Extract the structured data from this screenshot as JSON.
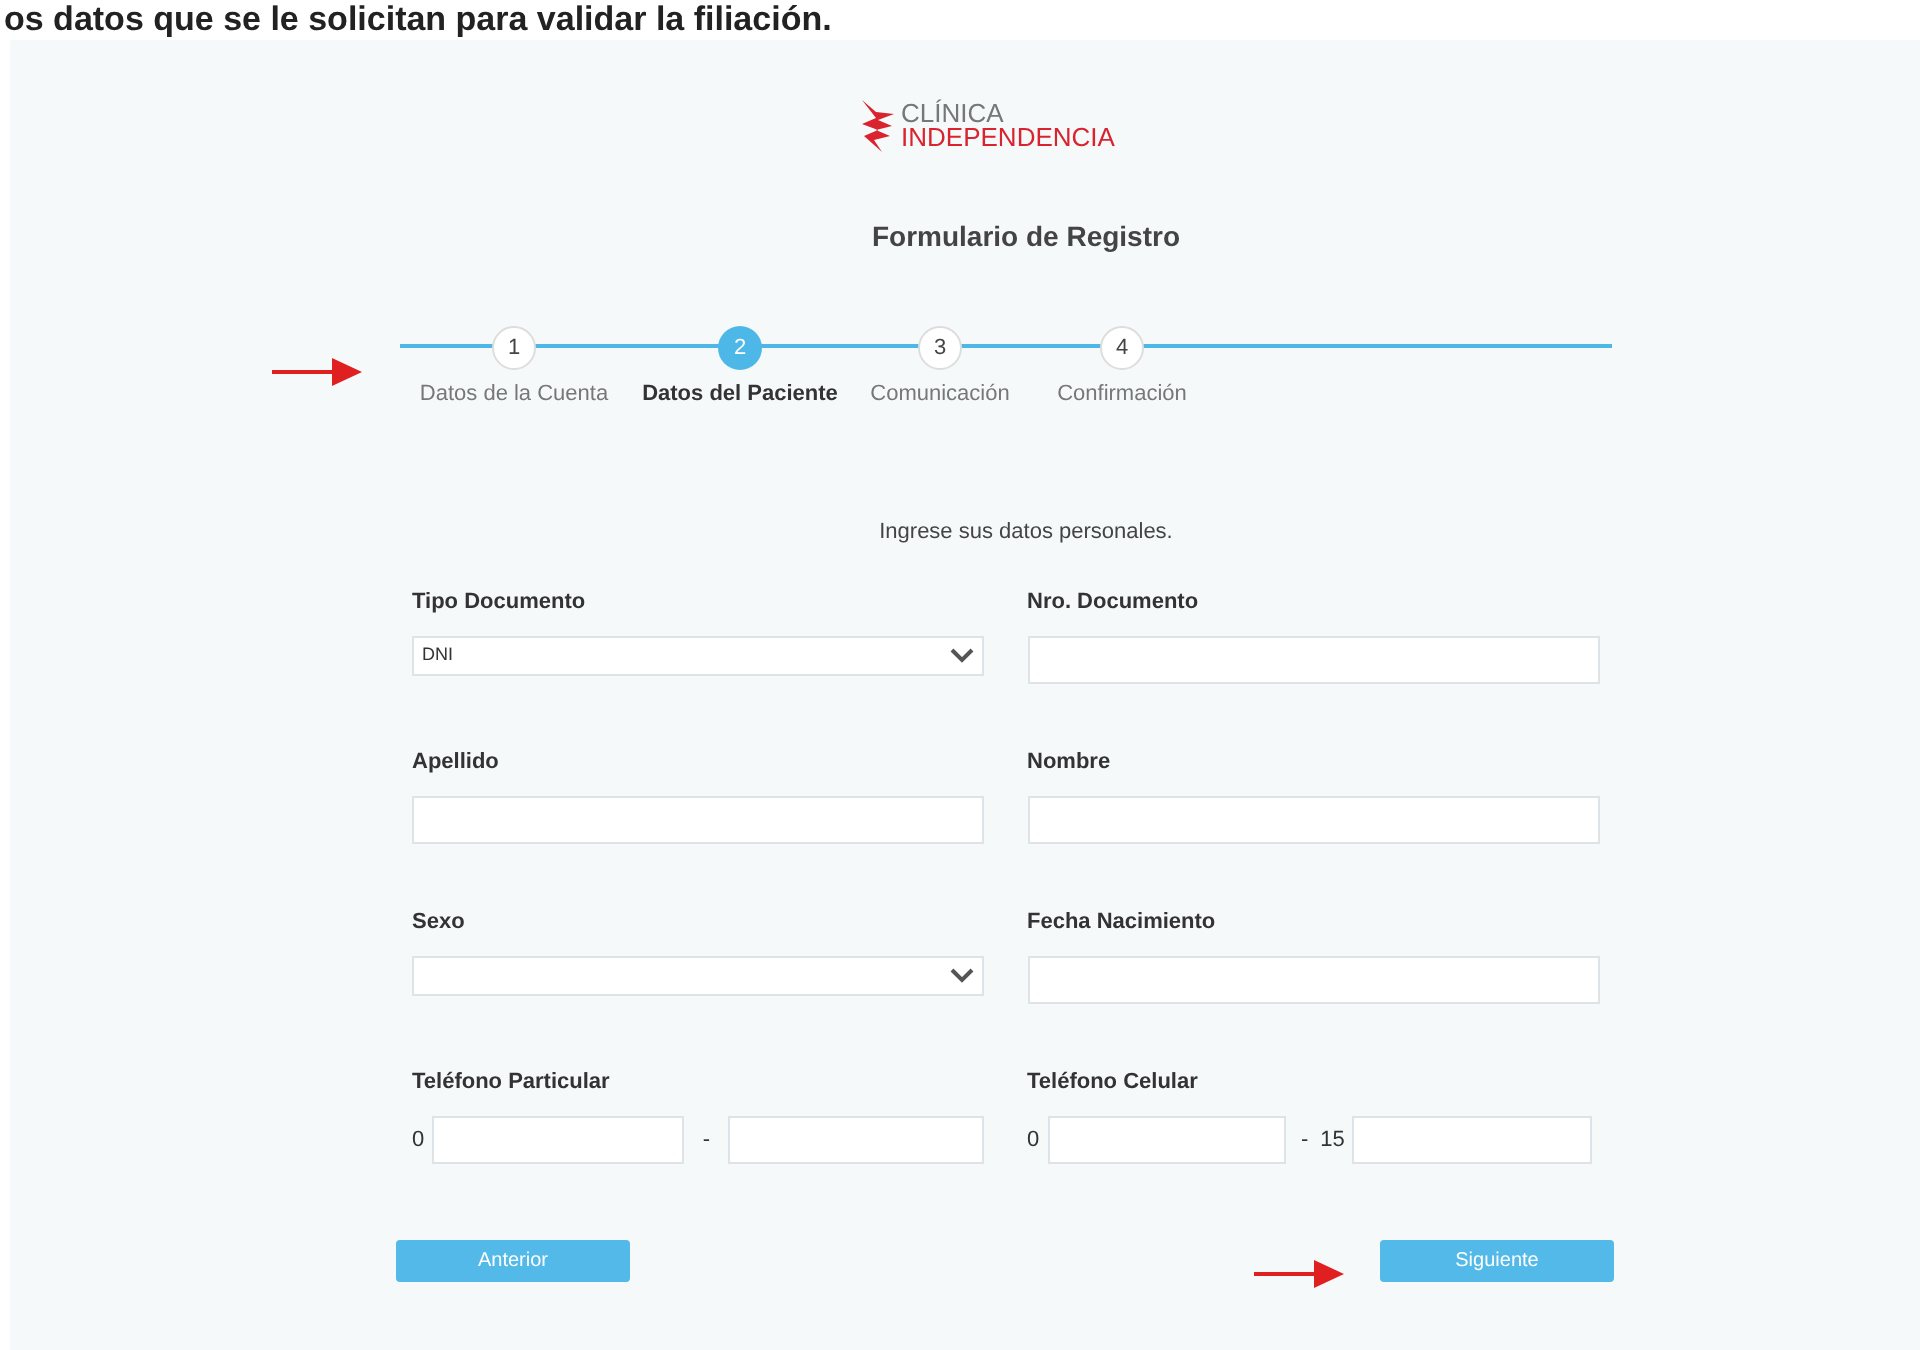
{
  "banner_text": "os datos que se le solicitan para validar la filiación.",
  "logo": {
    "line_1": "CLÍNICA",
    "line_2": "INDEPENDENCIA"
  },
  "title": "Formulario de Registro",
  "steps": [
    {
      "number": "1",
      "label": "Datos de la Cuenta",
      "selected": false
    },
    {
      "number": "2",
      "label": "Datos del Paciente",
      "selected": true
    },
    {
      "number": "3",
      "label": "Comunicación",
      "selected": false
    },
    {
      "number": "4",
      "label": "Confirmación",
      "selected": false
    }
  ],
  "instruction": "Ingrese sus datos personales.",
  "fields": [
    {
      "kind": "select",
      "label": "Tipo Documento",
      "value": "DNI"
    },
    {
      "kind": "text",
      "label": "Nro. Documento"
    },
    {
      "kind": "text",
      "label": "Apellido"
    },
    {
      "kind": "text",
      "label": "Nombre"
    },
    {
      "kind": "select",
      "label": "Sexo"
    },
    {
      "kind": "text",
      "label": "Fecha Nacimiento"
    },
    {
      "kind": "phone",
      "label": "Teléfono Particular",
      "prefix": "0",
      "separator": "-"
    },
    {
      "kind": "phone",
      "label": "Teléfono Celular",
      "prefix": "0",
      "separator": "-",
      "mid_prefix": "15"
    }
  ],
  "buttons": [
    {
      "label": "Anterior"
    },
    {
      "label": "Siguiente"
    }
  ]
}
